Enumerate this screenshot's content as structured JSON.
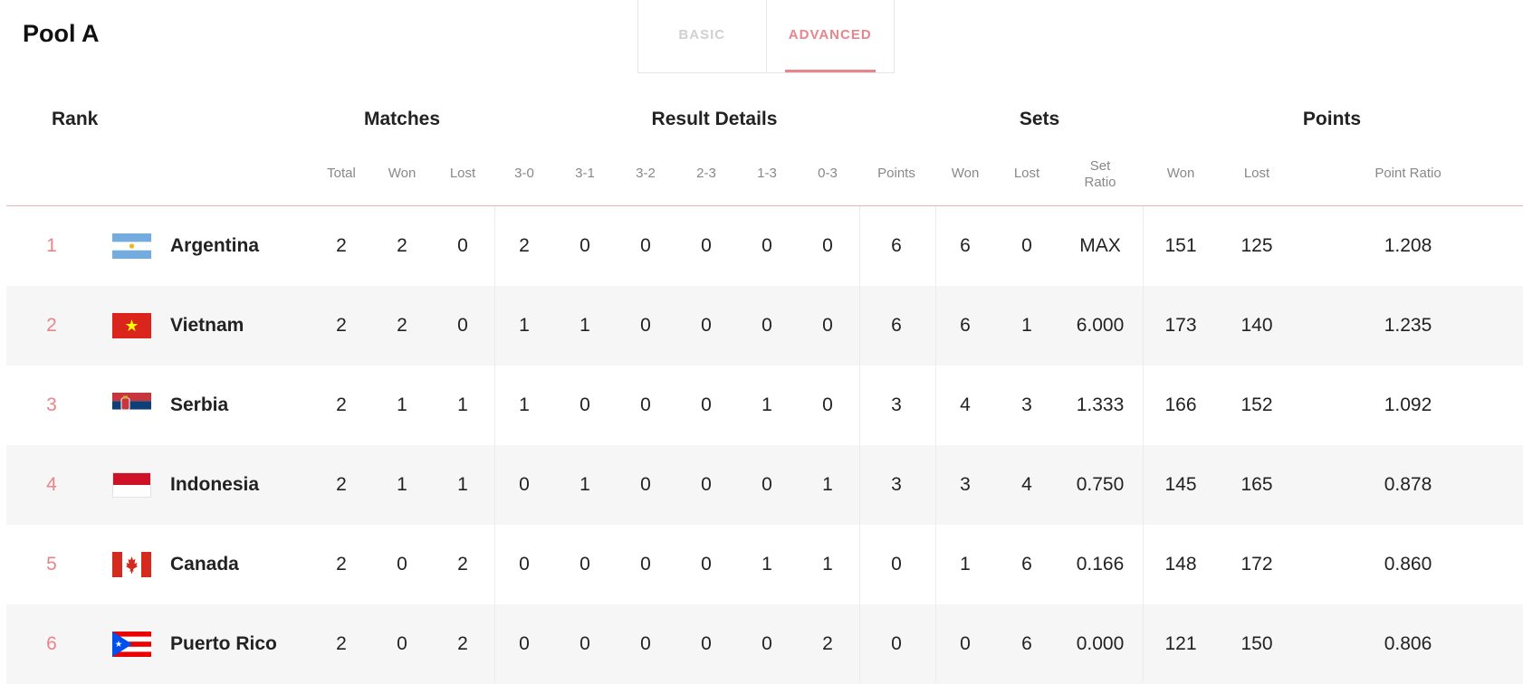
{
  "pool_title": "Pool A",
  "tabs": {
    "basic": "BASIC",
    "advanced": "ADVANCED",
    "active": "advanced"
  },
  "headers": {
    "rank": "Rank",
    "matches": "Matches",
    "result_details": "Result Details",
    "sets": "Sets",
    "points": "Points",
    "sub": {
      "total": "Total",
      "won": "Won",
      "lost": "Lost",
      "r30": "3-0",
      "r31": "3-1",
      "r32": "3-2",
      "r23": "2-3",
      "r13": "1-3",
      "r03": "0-3",
      "points": "Points",
      "sets_won": "Won",
      "sets_lost": "Lost",
      "set_ratio": "Set\nRatio",
      "points_won": "Won",
      "points_lost": "Lost",
      "point_ratio": "Point Ratio"
    }
  },
  "rows": [
    {
      "rank": "1",
      "country": "Argentina",
      "flag": "argentina-flag",
      "total": "2",
      "won": "2",
      "lost": "0",
      "r30": "2",
      "r31": "0",
      "r32": "0",
      "r23": "0",
      "r13": "0",
      "r03": "0",
      "points": "6",
      "sets_won": "6",
      "sets_lost": "0",
      "set_ratio": "MAX",
      "points_won": "151",
      "points_lost": "125",
      "point_ratio": "1.208"
    },
    {
      "rank": "2",
      "country": "Vietnam",
      "flag": "vietnam-flag",
      "total": "2",
      "won": "2",
      "lost": "0",
      "r30": "1",
      "r31": "1",
      "r32": "0",
      "r23": "0",
      "r13": "0",
      "r03": "0",
      "points": "6",
      "sets_won": "6",
      "sets_lost": "1",
      "set_ratio": "6.000",
      "points_won": "173",
      "points_lost": "140",
      "point_ratio": "1.235"
    },
    {
      "rank": "3",
      "country": "Serbia",
      "flag": "serbia-flag",
      "total": "2",
      "won": "1",
      "lost": "1",
      "r30": "1",
      "r31": "0",
      "r32": "0",
      "r23": "0",
      "r13": "1",
      "r03": "0",
      "points": "3",
      "sets_won": "4",
      "sets_lost": "3",
      "set_ratio": "1.333",
      "points_won": "166",
      "points_lost": "152",
      "point_ratio": "1.092"
    },
    {
      "rank": "4",
      "country": "Indonesia",
      "flag": "indonesia-flag",
      "total": "2",
      "won": "1",
      "lost": "1",
      "r30": "0",
      "r31": "1",
      "r32": "0",
      "r23": "0",
      "r13": "0",
      "r03": "1",
      "points": "3",
      "sets_won": "3",
      "sets_lost": "4",
      "set_ratio": "0.750",
      "points_won": "145",
      "points_lost": "165",
      "point_ratio": "0.878"
    },
    {
      "rank": "5",
      "country": "Canada",
      "flag": "canada-flag",
      "total": "2",
      "won": "0",
      "lost": "2",
      "r30": "0",
      "r31": "0",
      "r32": "0",
      "r23": "0",
      "r13": "1",
      "r03": "1",
      "points": "0",
      "sets_won": "1",
      "sets_lost": "6",
      "set_ratio": "0.166",
      "points_won": "148",
      "points_lost": "172",
      "point_ratio": "0.860"
    },
    {
      "rank": "6",
      "country": "Puerto Rico",
      "flag": "puerto-rico-flag",
      "total": "2",
      "won": "0",
      "lost": "2",
      "r30": "0",
      "r31": "0",
      "r32": "0",
      "r23": "0",
      "r13": "0",
      "r03": "2",
      "points": "0",
      "sets_won": "0",
      "sets_lost": "6",
      "set_ratio": "0.000",
      "points_won": "121",
      "points_lost": "150",
      "point_ratio": "0.806"
    }
  ],
  "colors": {
    "accent": "#e8858c",
    "row_alt": "#f6f6f6",
    "header_line": "#e9b3b7"
  }
}
